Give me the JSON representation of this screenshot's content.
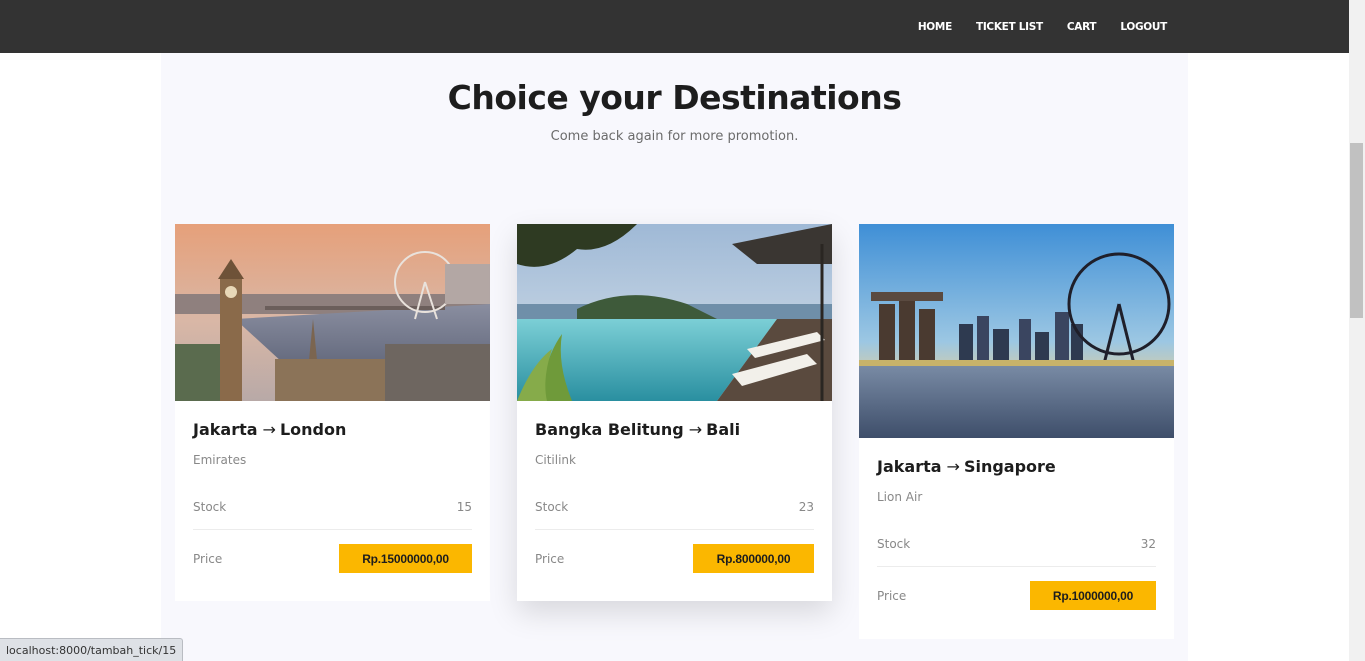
{
  "nav": {
    "items": [
      "HOME",
      "TICKET LIST",
      "CART",
      "LOGOUT"
    ]
  },
  "hero": {
    "title": "Choice your Destinations",
    "subtitle": "Come back again for more promotion."
  },
  "labels": {
    "stock": "Stock",
    "price": "Price",
    "arrow": "→"
  },
  "cards": [
    {
      "from": "Jakarta",
      "to": "London",
      "airline": "Emirates",
      "stock": "15",
      "price": "Rp.15000000,00",
      "image": "london-skyline-image"
    },
    {
      "from": "Bangka Belitung",
      "to": "Bali",
      "airline": "Citilink",
      "stock": "23",
      "price": "Rp.800000,00",
      "image": "bali-pool-image"
    },
    {
      "from": "Jakarta",
      "to": "Singapore",
      "airline": "Lion Air",
      "stock": "32",
      "price": "Rp.1000000,00",
      "image": "singapore-skyline-image"
    }
  ],
  "status_url": "localhost:8000/tambah_tick/15",
  "colors": {
    "navbar": "#333333",
    "accent": "#fbb700",
    "section_bg": "#f8f8fd"
  }
}
